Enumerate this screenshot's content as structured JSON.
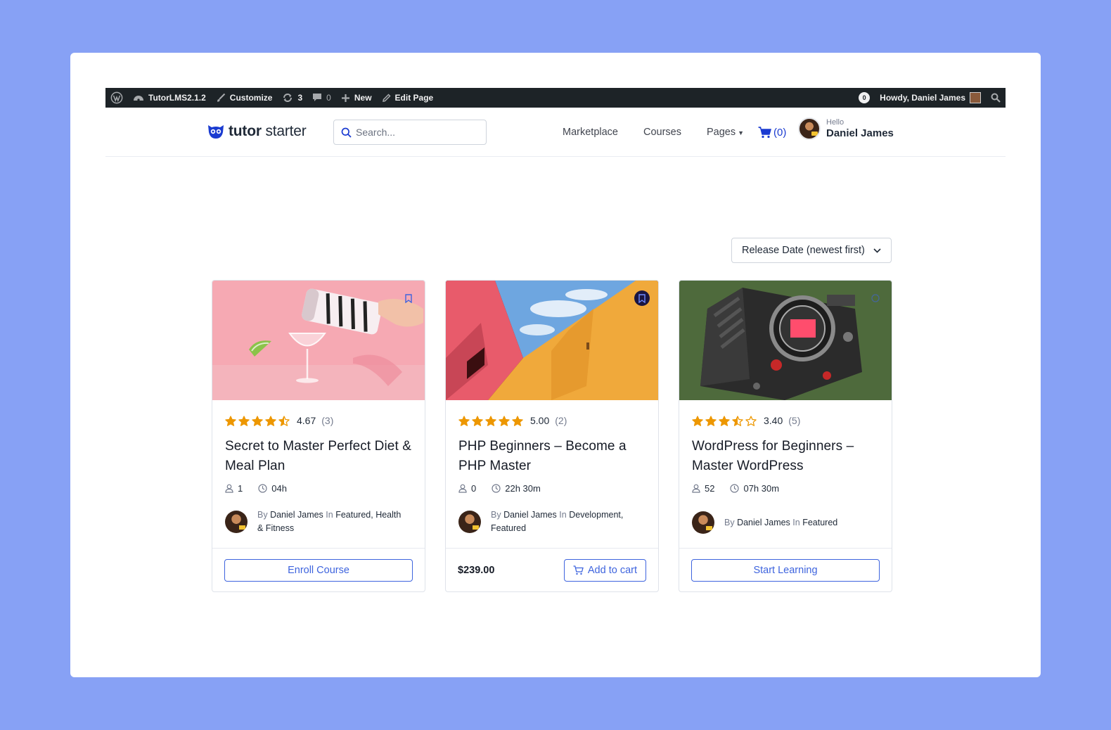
{
  "adminbar": {
    "site_name": "TutorLMS2.1.2",
    "customize": "Customize",
    "updates_count": "3",
    "comments_count": "0",
    "new_label": "New",
    "edit_page": "Edit Page",
    "notif_count": "0",
    "howdy": "Howdy, Daniel James"
  },
  "header": {
    "logo_bold": "tutor",
    "logo_light": " starter",
    "search_placeholder": "Search...",
    "nav": [
      "Marketplace",
      "Courses",
      "Pages"
    ],
    "cart_count": "(0)",
    "hello": "Hello",
    "user_name": "Daniel James"
  },
  "sort": {
    "selected": "Release Date (newest first)"
  },
  "colors": {
    "accent": "#3e64de",
    "star": "#ed9700",
    "adminbar": "#1d2327",
    "background": "#87a1f5"
  },
  "courses": [
    {
      "rating": 4.67,
      "rating_text": "4.67",
      "reviews": "(3)",
      "title": "Secret to Master Perfect Diet & Meal Plan",
      "students": "1",
      "duration": "04h",
      "by": "By",
      "author": "Daniel James",
      "in": "In",
      "categories_line1": "Featured, Health",
      "categories_line2": "& Fitness",
      "action": "Enroll Course"
    },
    {
      "rating": 5.0,
      "rating_text": "5.00",
      "reviews": "(2)",
      "title": "PHP Beginners – Become a PHP Master",
      "students": "0",
      "duration": "22h 30m",
      "by": "By",
      "author": "Daniel James",
      "in": "In",
      "categories_line1": "Development,",
      "categories_line2": "Featured",
      "price": "$239.00",
      "action": "Add to cart"
    },
    {
      "rating": 3.4,
      "rating_text": "3.40",
      "reviews": "(5)",
      "title": "WordPress for Beginners – Master WordPress",
      "students": "52",
      "duration": "07h 30m",
      "by": "By",
      "author": "Daniel James",
      "in": "In",
      "categories_line1": "Featured",
      "action": "Start Learning"
    }
  ]
}
